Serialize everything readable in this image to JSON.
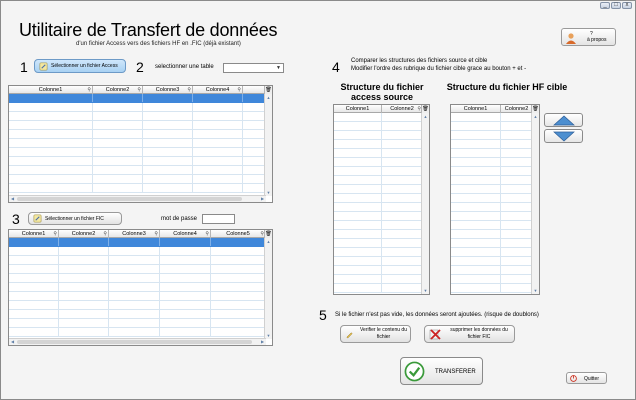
{
  "window": {
    "controls": [
      "_",
      "□",
      "x"
    ]
  },
  "header": {
    "title": "Utilitaire de Transfert de données",
    "subtitle": "d'un fichier Access vers des fichiers HF en .FIC (déjà existant)"
  },
  "about_button": {
    "line1": "?",
    "line2": "à propos"
  },
  "step1": {
    "number": "1",
    "button_label": "Sélectionner un fichier Access"
  },
  "step2": {
    "number": "2",
    "label": "selectionner une table",
    "select_value": ""
  },
  "step3": {
    "number": "3",
    "button_label": "Sélectionner un fichier FIC",
    "password_label": "mot de passe",
    "password_value": ""
  },
  "step4": {
    "number": "4",
    "text_line1": "Comparer les structures des fichiers source et cible",
    "text_line2": "Modifier l'ordre des rubrique du fichier cible grace au bouton + et -",
    "source_title_line1": "Structure du fichier",
    "source_title_line2": "access source",
    "target_title": "Structure du fichier HF cible"
  },
  "step5": {
    "number": "5",
    "text": "Si le fichier n'est pas vide, les données seront ajoutées. (risque de doublons)",
    "verify_line1": "Verifier le contenu du",
    "verify_line2": "fichier",
    "delete_line1": "supprimer les données du",
    "delete_line2": "fichier FIC"
  },
  "grid_access": {
    "columns": [
      "Colonne1",
      "Colonne2",
      "Colonne3",
      "Colonne4",
      ""
    ]
  },
  "grid_fic": {
    "columns": [
      "Colonne1",
      "Colonne2",
      "Colonne3",
      "Colonne4",
      "Colonne5"
    ]
  },
  "grid_source_struct": {
    "columns": [
      "Colonne1",
      "Colonne2"
    ]
  },
  "grid_target_struct": {
    "columns": [
      "Colonne1",
      "Colonne2"
    ]
  },
  "transfer_button": {
    "label": "TRANSFERER"
  },
  "quit_button": {
    "label": "Quitter"
  },
  "colors": {
    "selected_row": "#3f87da",
    "accent_blue": "#2f6fb4",
    "check_green": "#3a9a3a",
    "delete_red": "#cc2222"
  }
}
